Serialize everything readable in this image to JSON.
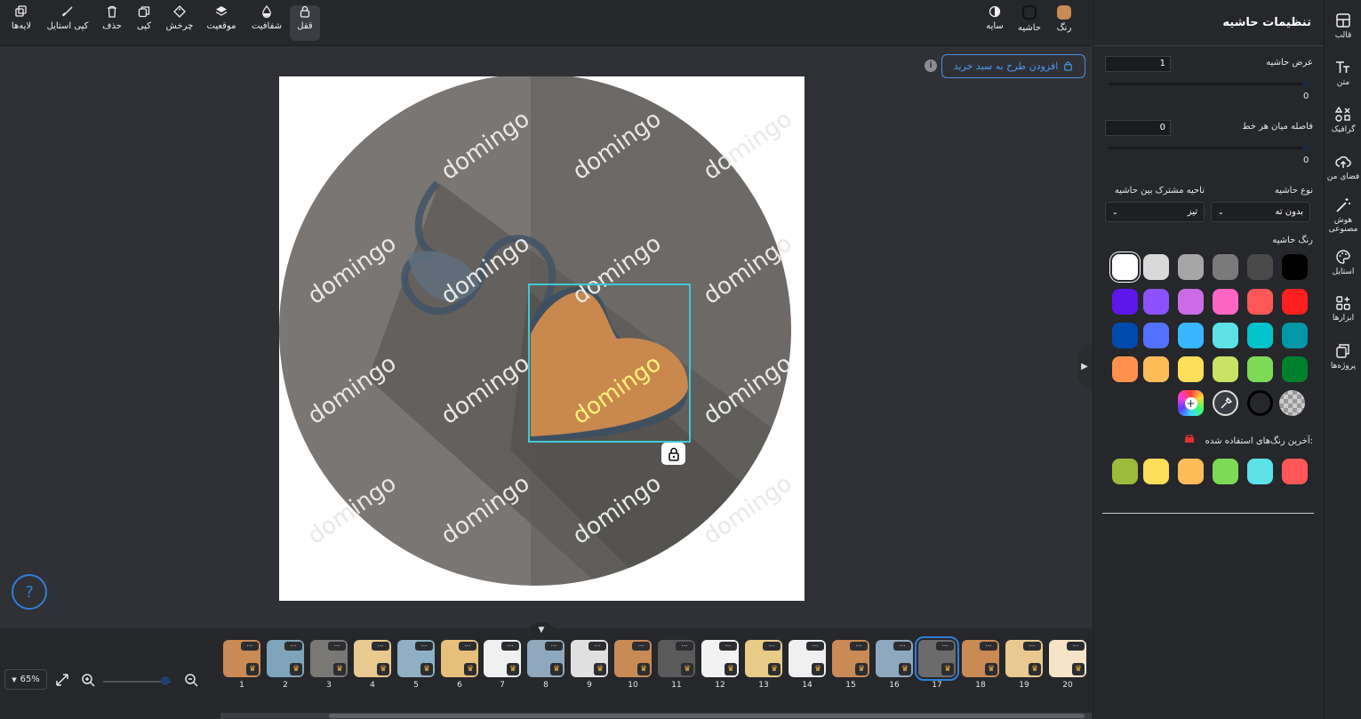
{
  "toolbar": {
    "layers": "لایه‌ها",
    "copy_style": "کپی استایل",
    "delete": "حذف",
    "copy": "کپی",
    "rotate": "چرخش",
    "position": "موقعیت",
    "opacity": "شفافیت",
    "lock": "قفل",
    "shadow": "سایه",
    "border": "حاشیه",
    "color": "رنگ",
    "color_value": "#c98a55"
  },
  "canvas": {
    "add_to_cart": "افزودن طرح به سبد خرید",
    "info": "i",
    "watermark": "domingo",
    "help": "?"
  },
  "zoom": {
    "value": "65%"
  },
  "pages": {
    "items": [
      "1",
      "2",
      "3",
      "4",
      "5",
      "6",
      "7",
      "8",
      "9",
      "10",
      "11",
      "12",
      "13",
      "14",
      "15",
      "16",
      "17",
      "18",
      "19",
      "20"
    ],
    "selected": "17",
    "menu_label": "...",
    "bg_colors": [
      "#c98a55",
      "#7fa3b8",
      "#7a7874",
      "#e8c98f",
      "#8fb0c4",
      "#e6c07a",
      "#f0f0f0",
      "#8fa8bd",
      "#e0e0e0",
      "#c98a55",
      "#5a5a5a",
      "#f2f2f2",
      "#e7cc88",
      "#f0f0f0",
      "#c98a55",
      "#8fa8bd",
      "#6b6b6b",
      "#c98a55",
      "#e8c98f",
      "#f5e4c8"
    ]
  },
  "panel": {
    "title": "تنظیمات حاشیه",
    "border_width_label": "عرض حاشیه",
    "border_width_value": "1",
    "border_width_slider": "0",
    "dash_gap_label": "فاصله میان هر خط",
    "dash_gap_value": "0",
    "dash_gap_slider": "0",
    "border_type_label": "نوع حاشیه",
    "border_type_value": "بدون ته",
    "join_label": "ناحیه مشترک بین حاشیه",
    "join_value": "تیز",
    "border_color_label": "رنگ حاشیه",
    "recent_label": "آخرین رنگ‌های استفاده شده:",
    "palette": [
      "#000000",
      "#4a4a4a",
      "#7a7a7a",
      "#a6a6a6",
      "#d9d9d9",
      "#ffffff",
      "#ff1f1f",
      "#ff5757",
      "#ff66c4",
      "#cb6ce6",
      "#8c52ff",
      "#5e17eb",
      "#0097a7",
      "#00c2cb",
      "#5ce1e6",
      "#38b6ff",
      "#5271ff",
      "#004aad",
      "#00802b",
      "#7ed957",
      "#c9e265",
      "#ffde59",
      "#ffbd59",
      "#ff914d"
    ],
    "recent_colors": [
      "#ff5757",
      "#5ce1e6",
      "#7ed957",
      "#ffbd59",
      "#ffde59",
      "#9cbb3b"
    ]
  },
  "sidebar": {
    "template": "قالب",
    "text": "متن",
    "graphic": "گرافیک",
    "my_space": "فضای من",
    "ai": "هوش مصنوعی",
    "style": "استایل",
    "tools": "ابزارها",
    "projects": "پروژه‌ها"
  }
}
